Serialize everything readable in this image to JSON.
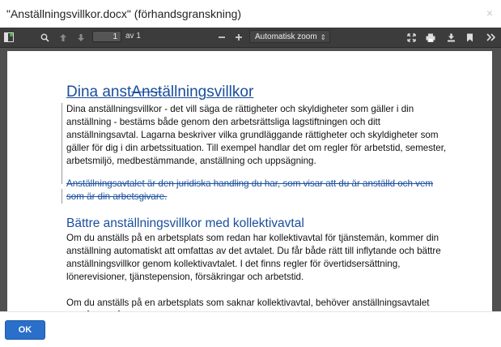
{
  "dialog": {
    "title": "\"Anställningsvillkor.docx\" (förhandsgranskning)",
    "close_glyph": "×",
    "ok_label": "OK",
    "accent_color": "#2a6fc9"
  },
  "toolbar": {
    "page_number": "1",
    "page_count_label": "av 1",
    "zoom_label": "Automatisk zoom",
    "icons": [
      "sidebar-toggle-icon",
      "search-icon",
      "previous-page-icon",
      "next-page-icon",
      "zoom-out-icon",
      "zoom-in-icon",
      "presentation-mode-icon",
      "print-icon",
      "download-icon",
      "bookmark-icon",
      "tools-icon"
    ]
  },
  "document": {
    "heading_inserted": "Dina anst",
    "heading_deleted": "Anst",
    "heading_rest": "ällningsvillkor",
    "paragraph1": "Dina anställningsvillkor - det vill säga de rättigheter och skyldigheter som gäller i din anställning - bestäms både genom den arbetsrättsliga lagstiftningen och ditt anställningsavtal. Lagarna beskriver vilka grundläggande rättigheter och skyldigheter som gäller för dig i din arbetssituation. Till exempel handlar det om regler för arbetstid, semester, arbetsmiljö, medbestämmande, anställning och uppsägning.",
    "deleted_paragraph": "Anställningsavtalet är den juridiska handling du har, som visar att du är anställd och vem som är din arbetsgivare.",
    "heading2": "Bättre anställningsvillkor med kollektivavtal",
    "paragraph2": "Om du anställs på en arbetsplats som redan har kollektivavtal för tjänstemän, kommer din anställning automatiskt att omfattas av det avtalet. Du får både rätt till inflytande och bättre anställningsvillkor genom kollektivavtalet. I det finns regler för övertidsersättning, lönerevisioner, tjänstepension, försäkringar och arbetstid.",
    "paragraph3": "Om du anställs på en arbetsplats som saknar kollektivavtal, behöver anställningsavtalet också innehålla uppgifter om bland annat tjänstepension, försäkringar, övertids- och"
  }
}
